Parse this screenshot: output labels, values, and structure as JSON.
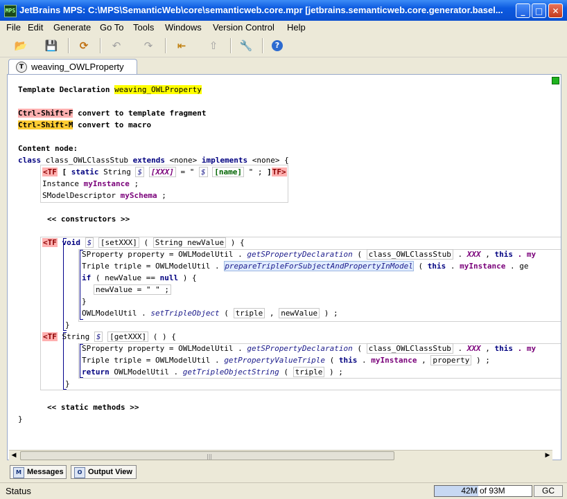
{
  "window": {
    "title": "JetBrains MPS: C:\\MPS\\SemanticWeb\\core\\semanticweb.core.mpr  [jetbrains.semanticweb.core.generator.basel...",
    "app_icon": "MPS",
    "min_glyph": "_",
    "max_glyph": "□",
    "close_glyph": "✕"
  },
  "menu": [
    "File",
    "Edit",
    "Generate",
    "Go To",
    "Tools",
    "Windows",
    "Version Control",
    "Help"
  ],
  "toolbar": {
    "icons": [
      "open-folder-icon",
      "save-icon",
      "refresh-icon",
      "undo-icon",
      "redo-icon",
      "back-icon",
      "up-icon",
      "settings-wrench-icon",
      "help-icon"
    ],
    "glyphs": [
      "📂",
      "💾",
      "⟳",
      "↶",
      "↷",
      "⇤",
      "⇧",
      "🔧",
      "?"
    ]
  },
  "tab": {
    "icon": "T",
    "label": "weaving_OWLProperty"
  },
  "code": {
    "l1_label": "Template Declaration ",
    "l1_name": "weaving_OWLProperty",
    "hint1_key": "Ctrl-Shift-F",
    "hint1_text": " convert to template fragment",
    "hint2_key": "Ctrl-Shift-M",
    "hint2_text": " convert to macro",
    "content_node": "Content node:",
    "class_kw": "class",
    "class_name": " class_OWLClassStub ",
    "extends_kw": "extends",
    "none1": " <none> ",
    "implements_kw": "implements",
    "none2": " <none> {",
    "tf_open": "<TF",
    "tf_close": "TF>",
    "f1_bracket": "[",
    "f1_static": "static",
    "f1_string": " String ",
    "dollar": "$",
    "xxx": "[XXX]",
    "eq_quote": " = \" ",
    "name_ref": "[name]",
    "end_quote": " \" ; ",
    "close_bracket": "]",
    "f2_type": "Instance ",
    "f2_name": "myInstance",
    "semi": " ;",
    "f3_type": "SModelDescriptor ",
    "f3_name": "mySchema",
    "constructors": "<< constructors >>",
    "m1_void": "void",
    "m1_name": "[setXXX]",
    "m1_params": " ( ",
    "m1_param": "String newValue",
    "m1_end": " ) {",
    "s1_a": "SProperty property = OWLModelUtil . ",
    "s1_call": "getSPropertyDeclaration",
    "s1_b": " ( ",
    "s1_arg": "class_OWLClassStub",
    "s1_c": " . ",
    "s1_xxx": "XXX",
    "s1_d": " , ",
    "this_kw": "this",
    "s1_e": " . my",
    "s2_a": "Triple triple = OWLModelUtil . ",
    "s2_call": "prepareTripleForSubjectAndPropertyInModel",
    "s2_b": " ( ",
    "s2_c": " . ",
    "s2_myinst": "myInstance",
    "s2_d": " . ge",
    "if_kw": "if",
    "if_a": " ( newValue == ",
    "null_kw": "null",
    "if_b": " ) {",
    "assign": "newValue = \"  \" ;",
    "close_brace": "}",
    "s4_a": "OWLModelUtil . ",
    "s4_call": "setTripleObject",
    "s4_b": " ( ",
    "s4_arg1": "triple",
    "s4_c": " , ",
    "s4_arg2": "newValue",
    "s4_d": " ) ;",
    "m2_type": "String ",
    "m2_name": "[getXXX]",
    "m2_end": " ( ) {",
    "s5_a": "SProperty property = OWLModelUtil . ",
    "s5_call": "getSPropertyDeclaration",
    "s6_a": "Triple triple = OWLModelUtil . ",
    "s6_call": "getPropertyValueTriple",
    "s6_b": " ( ",
    "s6_c": " . ",
    "s6_myinst": "myInstance",
    "s6_d": " , ",
    "s6_prop": "property",
    "s6_e": " ) ;",
    "return_kw": "return",
    "s7_a": " OWLModelUtil . ",
    "s7_call": "getTripleObjectString",
    "s7_b": " ( ",
    "s7_arg": "triple",
    "s7_c": " ) ;",
    "static_methods": "<< static methods >>",
    "class_close": "}"
  },
  "bottom_panel": {
    "messages_label": "Messages",
    "messages_icon": "M",
    "output_label": "Output View",
    "output_icon": "O"
  },
  "status": {
    "text": "Status",
    "memory": "42M of 93M",
    "memory_fraction": 0.45,
    "gc_label": "GC"
  }
}
